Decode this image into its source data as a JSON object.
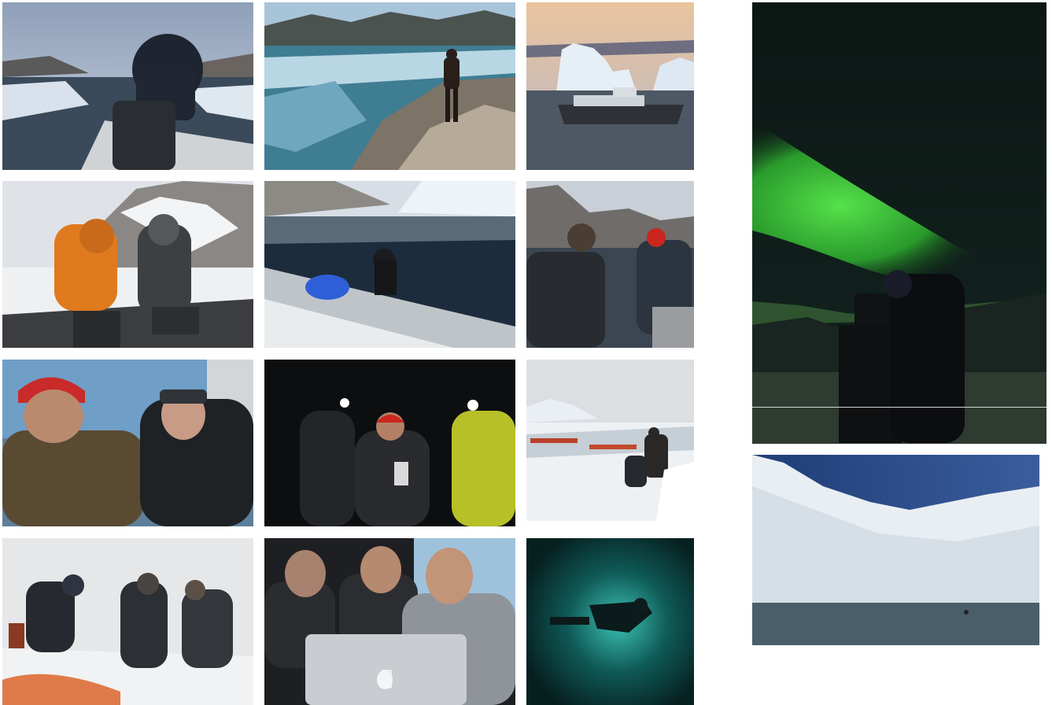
{
  "gallery": {
    "photos": [
      {
        "subject": "boat-ride-photo"
      },
      {
        "subject": "ice-fjord-photo"
      },
      {
        "subject": "iceberg-boat-photo"
      },
      {
        "subject": "snow-crew-photo"
      },
      {
        "subject": "diver-surface-photo"
      },
      {
        "subject": "dinghy-crew-photo"
      },
      {
        "subject": "diver-feeding-photo"
      },
      {
        "subject": "night-headlamps-photo"
      },
      {
        "subject": "sea-ice-camp-photo"
      },
      {
        "subject": "blizzard-photo"
      },
      {
        "subject": "laptop-review-photo"
      },
      {
        "subject": "underwater-diver-photo"
      },
      {
        "subject": "aurora-photo"
      },
      {
        "subject": "iceberg-wall-photo"
      }
    ]
  },
  "colors": {
    "background": "#ffffff",
    "aurora_green": "#3fd13a",
    "night_sky": "#0c1a18",
    "ice_blue": "#9ec6e0",
    "deep_water": "#0a3a3c"
  }
}
